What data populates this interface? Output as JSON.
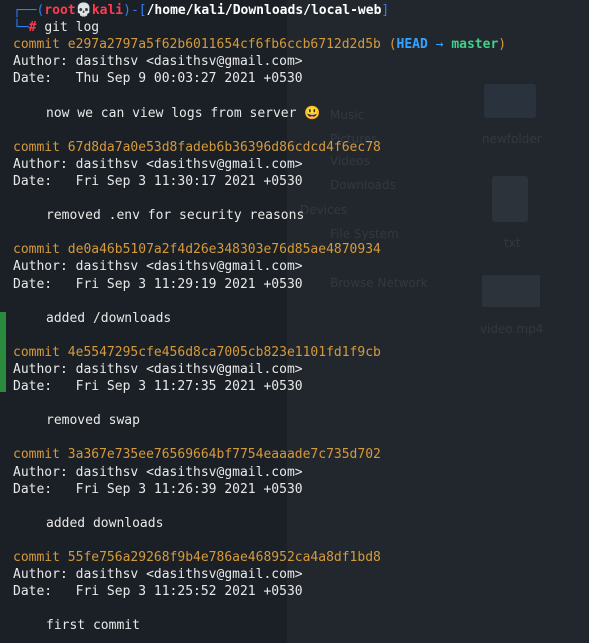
{
  "prompt": {
    "frame_top": "┌──(",
    "user": "root",
    "skull": "💀",
    "host": "kali",
    "sep": ")-[",
    "path": "/home/kali/Downloads/local-web",
    "close": "]",
    "frame_bottom": "└─",
    "hash": "#",
    "command": "git log"
  },
  "head_decoration": {
    "open": "(",
    "head": "HEAD",
    "arrow": "→",
    "branch": "master",
    "close": ")"
  },
  "commits": [
    {
      "commit_label": "commit",
      "hash": "e297a2797a5f62b6011654cf6fb6ccb6712d2d5b",
      "author_label": "Author:",
      "author": "dasithsv <dasithsv@gmail.com>",
      "date_label": "Date:",
      "date": "Thu Sep 9 00:03:27 2021 +0530",
      "message": "now we can view logs from server 😃"
    },
    {
      "commit_label": "commit",
      "hash": "67d8da7a0e53d8fadeb6b36396d86cdcd4f6ec78",
      "author_label": "Author:",
      "author": "dasithsv <dasithsv@gmail.com>",
      "date_label": "Date:",
      "date": "Fri Sep 3 11:30:17 2021 +0530",
      "message": "removed .env for security reasons"
    },
    {
      "commit_label": "commit",
      "hash": "de0a46b5107a2f4d26e348303e76d85ae4870934",
      "author_label": "Author:",
      "author": "dasithsv <dasithsv@gmail.com>",
      "date_label": "Date:",
      "date": "Fri Sep 3 11:29:19 2021 +0530",
      "message": "added /downloads"
    },
    {
      "commit_label": "commit",
      "hash": "4e5547295cfe456d8ca7005cb823e1101fd1f9cb",
      "author_label": "Author:",
      "author": "dasithsv <dasithsv@gmail.com>",
      "date_label": "Date:",
      "date": "Fri Sep 3 11:27:35 2021 +0530",
      "message": "removed swap"
    },
    {
      "commit_label": "commit",
      "hash": "3a367e735ee76569664bf7754eaaade7c735d702",
      "author_label": "Author:",
      "author": "dasithsv <dasithsv@gmail.com>",
      "date_label": "Date:",
      "date": "Fri Sep 3 11:26:39 2021 +0530",
      "message": "added downloads"
    },
    {
      "commit_label": "commit",
      "hash": "55fe756a29268f9b4e786ae468952ca4a8df1bd8",
      "author_label": "Author:",
      "author": "dasithsv <dasithsv@gmail.com>",
      "date_label": "Date:",
      "date": "Fri Sep 3 11:25:52 2021 +0530",
      "message": "first commit"
    }
  ],
  "background_file_manager": {
    "places": [
      "Music",
      "Pictures",
      "Videos",
      "Downloads",
      "File System",
      "Browse Network"
    ],
    "devices_heading": "Devices",
    "files": [
      "newfolder",
      "txt",
      "video.mp4"
    ]
  },
  "colors": {
    "background": "#151a1f",
    "prompt_frame": "#2f7ef5",
    "root_user": "#ff3b4e",
    "commit_hash": "#d59a3b",
    "head_ref": "#36a3ff",
    "branch": "#3fd08a",
    "text": "#e8e8e8"
  }
}
